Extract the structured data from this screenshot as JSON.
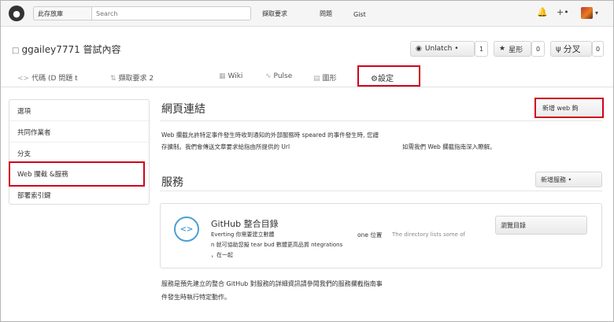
{
  "header": {
    "scope_label": "此存放庫",
    "search_placeholder": "Search",
    "nav": [
      "擷取要求",
      "問題",
      "Gist"
    ],
    "plus_label": "+•"
  },
  "repo": {
    "title": "ggailey7771 嘗試內容",
    "unwatch_label": "Unlatch •",
    "unwatch_count": "1",
    "star_label": "星形",
    "star_count": "0",
    "fork_label": "分叉",
    "fork_count": "0"
  },
  "tabs": {
    "code_label": "代碼 (D 問題 t",
    "pulls_label": "擷取要求  2",
    "wiki_label": "Wiki",
    "pulse_label": "Pulse",
    "graphs_label": "圖形",
    "settings_label": "設定"
  },
  "sidebar": {
    "items": [
      {
        "label": "選項"
      },
      {
        "label": "共同作業者"
      },
      {
        "label": "分支"
      },
      {
        "label": "Web 攔截 &服務"
      },
      {
        "label": "部署索引鍵"
      }
    ]
  },
  "webhooks": {
    "title": "網頁連結",
    "add_button": "新增 web 鉤",
    "desc_line1": "Web 攔截允許特定事件發生時收到通知的外部服務時 speared 的事件發生時, 您譜",
    "desc_line2a": "存擴制。我們會傳送文章要求給指由所提供的 Url",
    "desc_line2b": "如需我們 Web 攔截指南深入瞭解。"
  },
  "services": {
    "title": "服務",
    "add_button": "新增服務 •",
    "card": {
      "title": "GitHub 整合目錄",
      "line1": "Everting 你需要建立數體",
      "line2": "n 就可協助您擬 tear bud 數體更高品質 ntegrations",
      "line3": "，在一起",
      "mid": "one 位置",
      "mid2": "The directory lists some of",
      "browse_button": "瀏覽目錄"
    },
    "foot_line1": "服務是預先建立的整合 GitHub 對服務的詳細資訊請參閱我們的服務攔截指南事",
    "foot_line2": "件發生時執行特定動作。"
  }
}
